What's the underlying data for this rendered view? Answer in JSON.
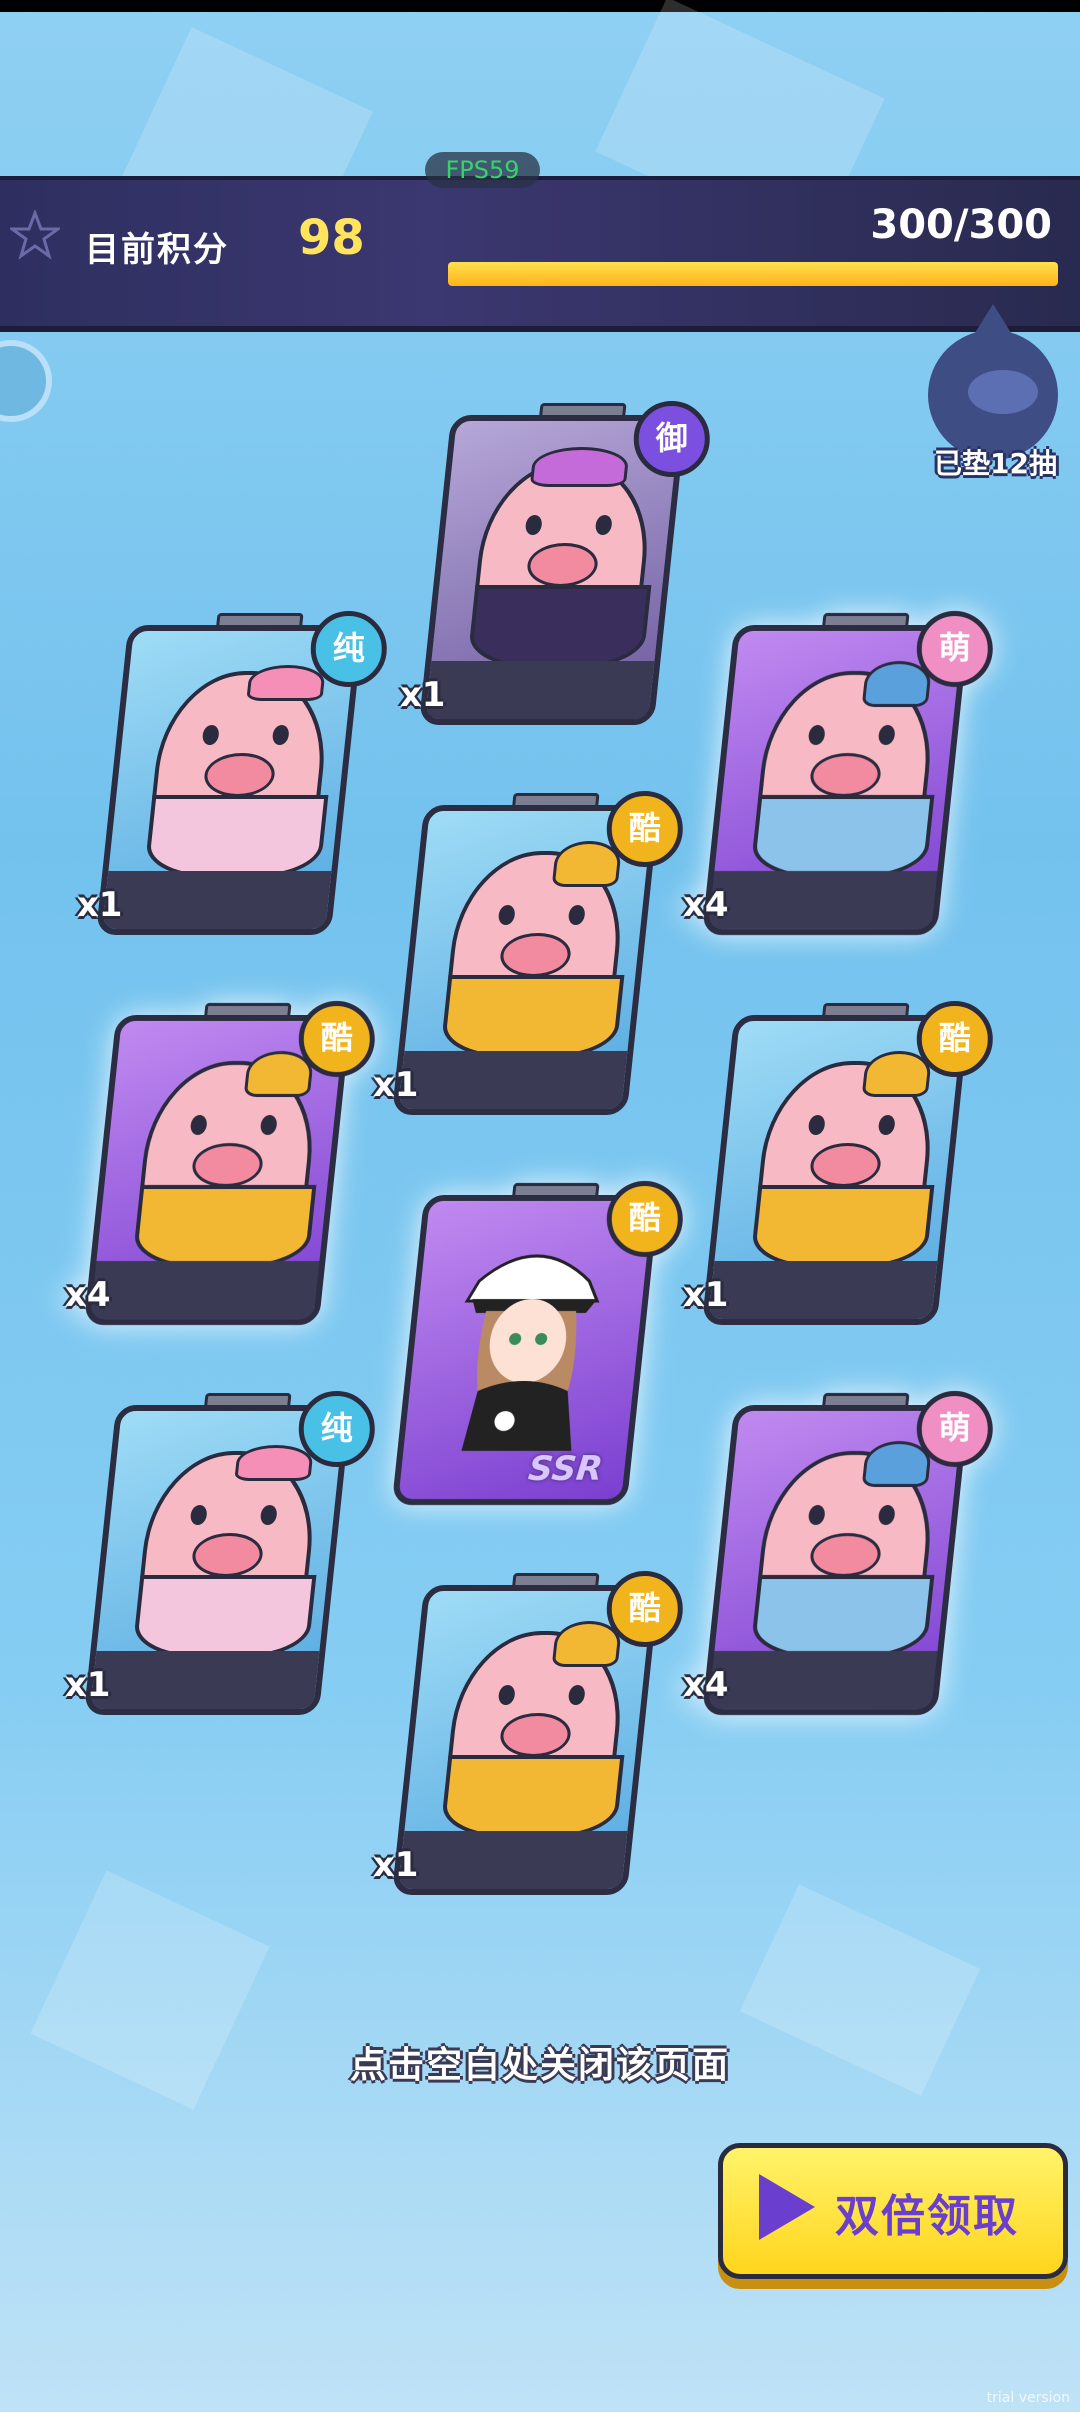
{
  "header": {
    "fps": "FPS59",
    "score_label": "目前积分",
    "score_value": "98",
    "progress_text": "300/300",
    "progress_fraction": 1.0
  },
  "pity": {
    "label": "已垫12抽"
  },
  "cards": [
    {
      "badge": "御",
      "badge_color": "#7b4fe0",
      "qty": "x1",
      "kind": "pig",
      "theme": "dark"
    },
    {
      "badge": "纯",
      "badge_color": "#49c1e6",
      "qty": "x1",
      "kind": "pig",
      "theme": "blue"
    },
    {
      "badge": "萌",
      "badge_color": "#f08fc3",
      "qty": "x4",
      "kind": "pig",
      "theme": "purple"
    },
    {
      "badge": "酷",
      "badge_color": "#f2b41d",
      "qty": "x1",
      "kind": "pig",
      "theme": "blue"
    },
    {
      "badge": "酷",
      "badge_color": "#f2b41d",
      "qty": "x4",
      "kind": "pig",
      "theme": "purple"
    },
    {
      "badge": "酷",
      "badge_color": "#f2b41d",
      "qty": "x1",
      "kind": "pig",
      "theme": "blue"
    },
    {
      "badge": "酷",
      "badge_color": "#f2b41d",
      "qty": "",
      "kind": "ssr",
      "theme": "purple",
      "ssr_label": "SSR"
    },
    {
      "badge": "纯",
      "badge_color": "#49c1e6",
      "qty": "x1",
      "kind": "pig",
      "theme": "blue"
    },
    {
      "badge": "萌",
      "badge_color": "#f08fc3",
      "qty": "x4",
      "kind": "pig",
      "theme": "purple"
    },
    {
      "badge": "酷",
      "badge_color": "#f2b41d",
      "qty": "x1",
      "kind": "pig",
      "theme": "blue"
    }
  ],
  "hint": "点击空白处关闭该页面",
  "claim_button": {
    "label": "双倍领取"
  },
  "watermark": "trial version"
}
